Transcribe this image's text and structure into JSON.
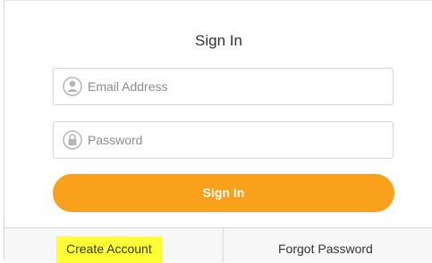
{
  "title": "Sign In",
  "email_field": {
    "placeholder": "Email Address",
    "icon": "user-icon"
  },
  "password_field": {
    "placeholder": "Password",
    "icon": "lock-icon"
  },
  "signin_button": {
    "label": "Sign In",
    "color": "#f9a11b"
  },
  "footer": {
    "create_account": "Create Account",
    "create_account_highlight": "#ffff33",
    "forgot_password": "Forgot Password"
  }
}
